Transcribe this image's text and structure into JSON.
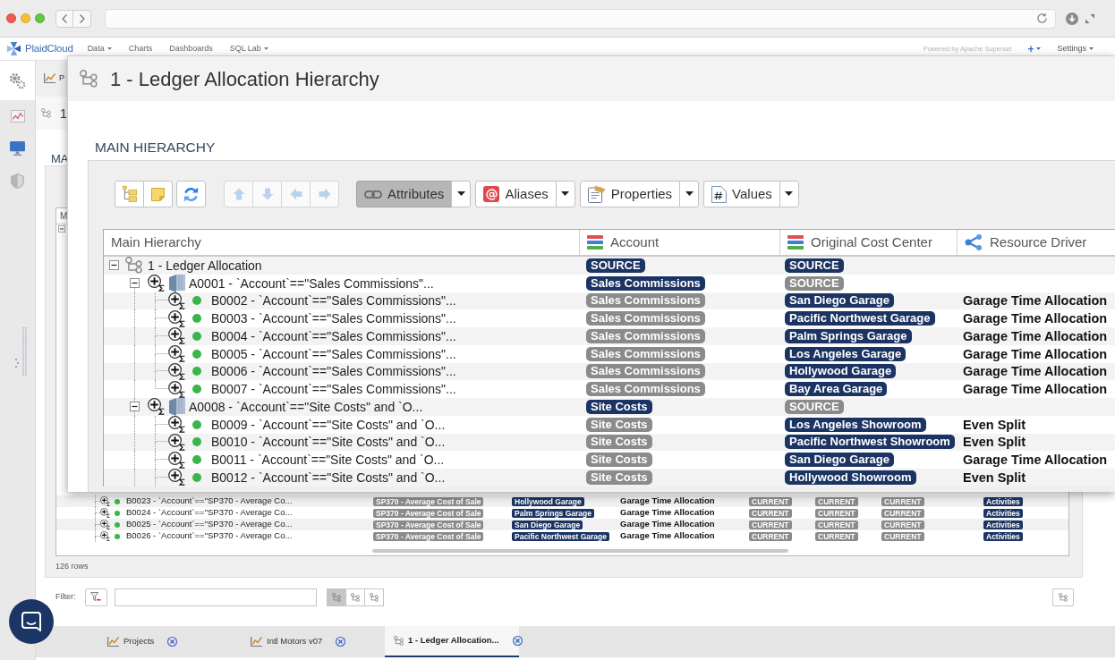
{
  "app_nav": {
    "logo": "PlaidCloud",
    "menus": [
      {
        "label": "Data",
        "dropdown": true
      },
      {
        "label": "Charts",
        "dropdown": false
      },
      {
        "label": "Dashboards",
        "dropdown": false
      },
      {
        "label": "SQL Lab",
        "dropdown": true
      }
    ],
    "powered_by": "Powered by Apache Superset",
    "right_menus": [
      {
        "label": "+",
        "kind": "add",
        "dropdown": true
      },
      {
        "label": "Settings",
        "kind": "text",
        "dropdown": true
      }
    ]
  },
  "sidebar": {
    "items": [
      {
        "kind": "gears",
        "selected": true
      },
      {
        "kind": "chart",
        "selected": false
      },
      {
        "kind": "monitor",
        "selected": false
      },
      {
        "kind": "shield",
        "selected": false
      }
    ]
  },
  "background": {
    "tab": {
      "label": "P"
    },
    "title": "1",
    "section": "MA",
    "grid": {
      "columns": [
        {
          "label": "M"
        }
      ],
      "root": {
        "expanded": true
      },
      "rows": [
        {
          "label": "B0023 - `Account`==\"SP370 - Average Co...",
          "cells": [
            {
              "kind": "tag",
              "text": "SP370 - Average Cost of Sale",
              "inherited": true
            },
            {
              "kind": "tag",
              "text": "Hollywood Garage",
              "inherited": false
            },
            {
              "kind": "text",
              "text": "Garage Time Allocation"
            },
            {
              "kind": "tag",
              "text": "CURRENT",
              "inherited": true
            },
            {
              "kind": "tag",
              "text": "CURRENT",
              "inherited": true
            },
            {
              "kind": "tag",
              "text": "CURRENT",
              "inherited": true
            },
            {
              "kind": "tag",
              "text": "Activities",
              "inherited": false
            }
          ]
        },
        {
          "label": "B0024 - `Account`==\"SP370 - Average Co...",
          "cells": [
            {
              "kind": "tag",
              "text": "SP370 - Average Cost of Sale",
              "inherited": true
            },
            {
              "kind": "tag",
              "text": "Palm Springs Garage",
              "inherited": false
            },
            {
              "kind": "text",
              "text": "Garage Time Allocation"
            },
            {
              "kind": "tag",
              "text": "CURRENT",
              "inherited": true
            },
            {
              "kind": "tag",
              "text": "CURRENT",
              "inherited": true
            },
            {
              "kind": "tag",
              "text": "CURRENT",
              "inherited": true
            },
            {
              "kind": "tag",
              "text": "Activities",
              "inherited": false
            }
          ]
        },
        {
          "label": "B0025 - `Account`==\"SP370 - Average Co...",
          "cells": [
            {
              "kind": "tag",
              "text": "SP370 - Average Cost of Sale",
              "inherited": true
            },
            {
              "kind": "tag",
              "text": "San Diego Garage",
              "inherited": false
            },
            {
              "kind": "text",
              "text": "Garage Time Allocation"
            },
            {
              "kind": "tag",
              "text": "CURRENT",
              "inherited": true
            },
            {
              "kind": "tag",
              "text": "CURRENT",
              "inherited": true
            },
            {
              "kind": "tag",
              "text": "CURRENT",
              "inherited": true
            },
            {
              "kind": "tag",
              "text": "Activities",
              "inherited": false
            }
          ]
        },
        {
          "label": "B0026 - `Account`==\"SP370 - Average Co...",
          "cells": [
            {
              "kind": "tag",
              "text": "SP370 - Average Cost of Sale",
              "inherited": true
            },
            {
              "kind": "tag",
              "text": "Pacific Northwest Garage",
              "inherited": false
            },
            {
              "kind": "text",
              "text": "Garage Time Allocation"
            },
            {
              "kind": "tag",
              "text": "CURRENT",
              "inherited": true
            },
            {
              "kind": "tag",
              "text": "CURRENT",
              "inherited": true
            },
            {
              "kind": "tag",
              "text": "CURRENT",
              "inherited": true
            },
            {
              "kind": "tag",
              "text": "Activities",
              "inherited": false
            }
          ]
        }
      ],
      "row_count": "126 rows"
    },
    "filter": {
      "label": "Filter:",
      "views": [
        {
          "selected": true
        },
        {
          "selected": false
        },
        {
          "selected": false
        }
      ]
    }
  },
  "bottom_tabs": [
    {
      "label": "Projects",
      "kind": "chart",
      "selected": false
    },
    {
      "label": "Intl Motors v07",
      "kind": "chart",
      "selected": false
    },
    {
      "label": "1 - Ledger Allocation...",
      "kind": "hierarchy",
      "selected": true
    }
  ],
  "dialog": {
    "title": "1 - Ledger Allocation Hierarchy",
    "section": "MAIN HIERARCHY",
    "toolbar": {
      "groups": [
        [
          {
            "kind": "tree",
            "disabled": false
          },
          {
            "kind": "note",
            "disabled": false
          }
        ],
        [
          {
            "kind": "refresh",
            "disabled": false
          }
        ],
        [
          {
            "kind": "up",
            "disabled": true
          },
          {
            "kind": "down",
            "disabled": true
          },
          {
            "kind": "left",
            "disabled": true
          },
          {
            "kind": "right",
            "disabled": true
          }
        ]
      ],
      "menus": [
        {
          "label": "Attributes",
          "kind": "link",
          "selected": true
        },
        {
          "label": "Aliases",
          "kind": "at",
          "selected": false
        },
        {
          "label": "Properties",
          "kind": "properties",
          "selected": false
        },
        {
          "label": "Values",
          "kind": "values",
          "selected": false
        }
      ]
    },
    "columns": [
      {
        "label": "Main Hierarchy",
        "kind": "tree"
      },
      {
        "label": "Account",
        "kind": "dimension"
      },
      {
        "label": "Original Cost Center",
        "kind": "dimension"
      },
      {
        "label": "Resource Driver",
        "kind": "driver"
      }
    ],
    "tree": [
      {
        "kind": "root",
        "label": "1 - Ledger Allocation",
        "expanded": true,
        "account": {
          "text": "SOURCE",
          "inherited": false
        },
        "cost_center": {
          "text": "SOURCE",
          "inherited": false
        },
        "children": [
          {
            "kind": "node",
            "label": "A0001 - `Account`==\"Sales Commissions\"...",
            "expanded": true,
            "account": {
              "text": "Sales Commissions",
              "inherited": false
            },
            "cost_center": {
              "text": "SOURCE",
              "inherited": true
            },
            "children": [
              {
                "kind": "leaf",
                "label": "B0002 - `Account`==\"Sales Commissions\"...",
                "account": {
                  "text": "Sales Commissions",
                  "inherited": true
                },
                "cost_center": {
                  "text": "San Diego Garage",
                  "inherited": false
                },
                "driver": "Garage Time Allocation"
              },
              {
                "kind": "leaf",
                "label": "B0003 - `Account`==\"Sales Commissions\"...",
                "account": {
                  "text": "Sales Commissions",
                  "inherited": true
                },
                "cost_center": {
                  "text": "Pacific Northwest Garage",
                  "inherited": false
                },
                "driver": "Garage Time Allocation"
              },
              {
                "kind": "leaf",
                "label": "B0004 - `Account`==\"Sales Commissions\"...",
                "account": {
                  "text": "Sales Commissions",
                  "inherited": true
                },
                "cost_center": {
                  "text": "Palm Springs Garage",
                  "inherited": false
                },
                "driver": "Garage Time Allocation"
              },
              {
                "kind": "leaf",
                "label": "B0005 - `Account`==\"Sales Commissions\"...",
                "account": {
                  "text": "Sales Commissions",
                  "inherited": true
                },
                "cost_center": {
                  "text": "Los Angeles Garage",
                  "inherited": false
                },
                "driver": "Garage Time Allocation"
              },
              {
                "kind": "leaf",
                "label": "B0006 - `Account`==\"Sales Commissions\"...",
                "account": {
                  "text": "Sales Commissions",
                  "inherited": true
                },
                "cost_center": {
                  "text": "Hollywood Garage",
                  "inherited": false
                },
                "driver": "Garage Time Allocation"
              },
              {
                "kind": "leaf",
                "label": "B0007 - `Account`==\"Sales Commissions\"...",
                "account": {
                  "text": "Sales Commissions",
                  "inherited": true
                },
                "cost_center": {
                  "text": "Bay Area Garage",
                  "inherited": false
                },
                "driver": "Garage Time Allocation"
              }
            ]
          },
          {
            "kind": "node",
            "label": "A0008 - `Account`==\"Site Costs\" and `O...",
            "expanded": true,
            "account": {
              "text": "Site Costs",
              "inherited": false
            },
            "cost_center": {
              "text": "SOURCE",
              "inherited": true
            },
            "children": [
              {
                "kind": "leaf",
                "label": "B0009 - `Account`==\"Site Costs\" and `O...",
                "account": {
                  "text": "Site Costs",
                  "inherited": true
                },
                "cost_center": {
                  "text": "Los Angeles Showroom",
                  "inherited": false
                },
                "driver": "Even Split"
              },
              {
                "kind": "leaf",
                "label": "B0010 - `Account`==\"Site Costs\" and `O...",
                "account": {
                  "text": "Site Costs",
                  "inherited": true
                },
                "cost_center": {
                  "text": "Pacific Northwest Showroom",
                  "inherited": false
                },
                "driver": "Even Split"
              },
              {
                "kind": "leaf",
                "label": "B0011 - `Account`==\"Site Costs\" and `O...",
                "account": {
                  "text": "Site Costs",
                  "inherited": true
                },
                "cost_center": {
                  "text": "San Diego Garage",
                  "inherited": false
                },
                "driver": "Garage Time Allocation"
              },
              {
                "kind": "leaf",
                "label": "B0012 - `Account`==\"Site Costs\" and `O...",
                "account": {
                  "text": "Site Costs",
                  "inherited": true
                },
                "cost_center": {
                  "text": "Hollywood Showroom",
                  "inherited": false
                },
                "driver": "Even Split"
              }
            ]
          }
        ]
      }
    ]
  }
}
